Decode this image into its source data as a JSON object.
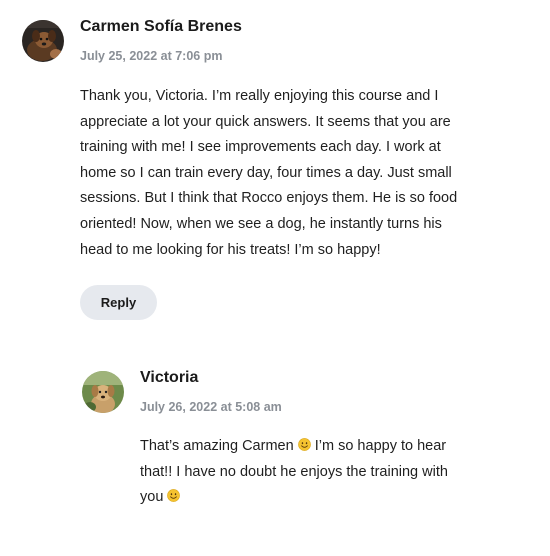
{
  "comments": [
    {
      "author": "Carmen Sofía Brenes",
      "date": "July 25, 2022 at 7:06 pm",
      "avatar_icon": "avatar-dog-photo",
      "lines": [
        "Thank you, Victoria. I’m really enjoying this course and I",
        "appreciate a lot your quick answers. It seems that you are",
        "training with me! I see improvements each day. I work at",
        "home so I can train every day, four times a day. Just small",
        "sessions. But I think that Rocco enjoys them. He is so food",
        "oriented! Now, when we see a dog, he instantly turns his",
        "head to me looking for his treats! I’m so happy!"
      ],
      "reply_label": "Reply"
    },
    {
      "author": "Victoria",
      "date": "July 26, 2022 at 5:08 am",
      "avatar_icon": "avatar-dog-outdoor-photo",
      "lines": [
        "That’s amazing Carmen",
        "I’m so happy to hear",
        "that!! I have no doubt he enjoys the training with",
        "you"
      ],
      "emoji_icon": "smiling-face-emoji"
    }
  ],
  "colors": {
    "reply_bg": "#e6e9ee",
    "date_text": "#8a8f96",
    "emoji_face": "#f5c330"
  }
}
